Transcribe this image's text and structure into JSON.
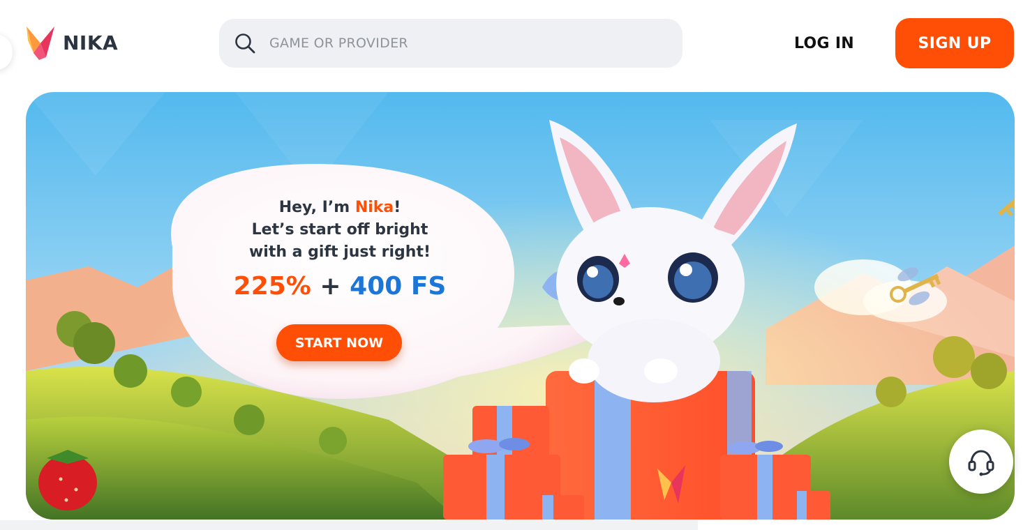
{
  "brand": {
    "name": "NIKA",
    "accent_color": "#ff4f06",
    "secondary_color": "#1b76d8"
  },
  "header": {
    "search": {
      "placeholder": "GAME OR PROVIDER",
      "icon": "search-icon"
    },
    "login_label": "LOG IN",
    "signup_label": "SIGN UP"
  },
  "banner": {
    "greeting_prefix": "Hey, I’m ",
    "greeting_name": "Nika",
    "greeting_suffix": "!",
    "line2": "Let’s start off bright",
    "line3": "with a gift just right!",
    "offer_percent": "225%",
    "offer_plus": "+",
    "offer_fs": "400 FS",
    "cta_label": "START NOW"
  },
  "support": {
    "icon": "headset-icon"
  }
}
